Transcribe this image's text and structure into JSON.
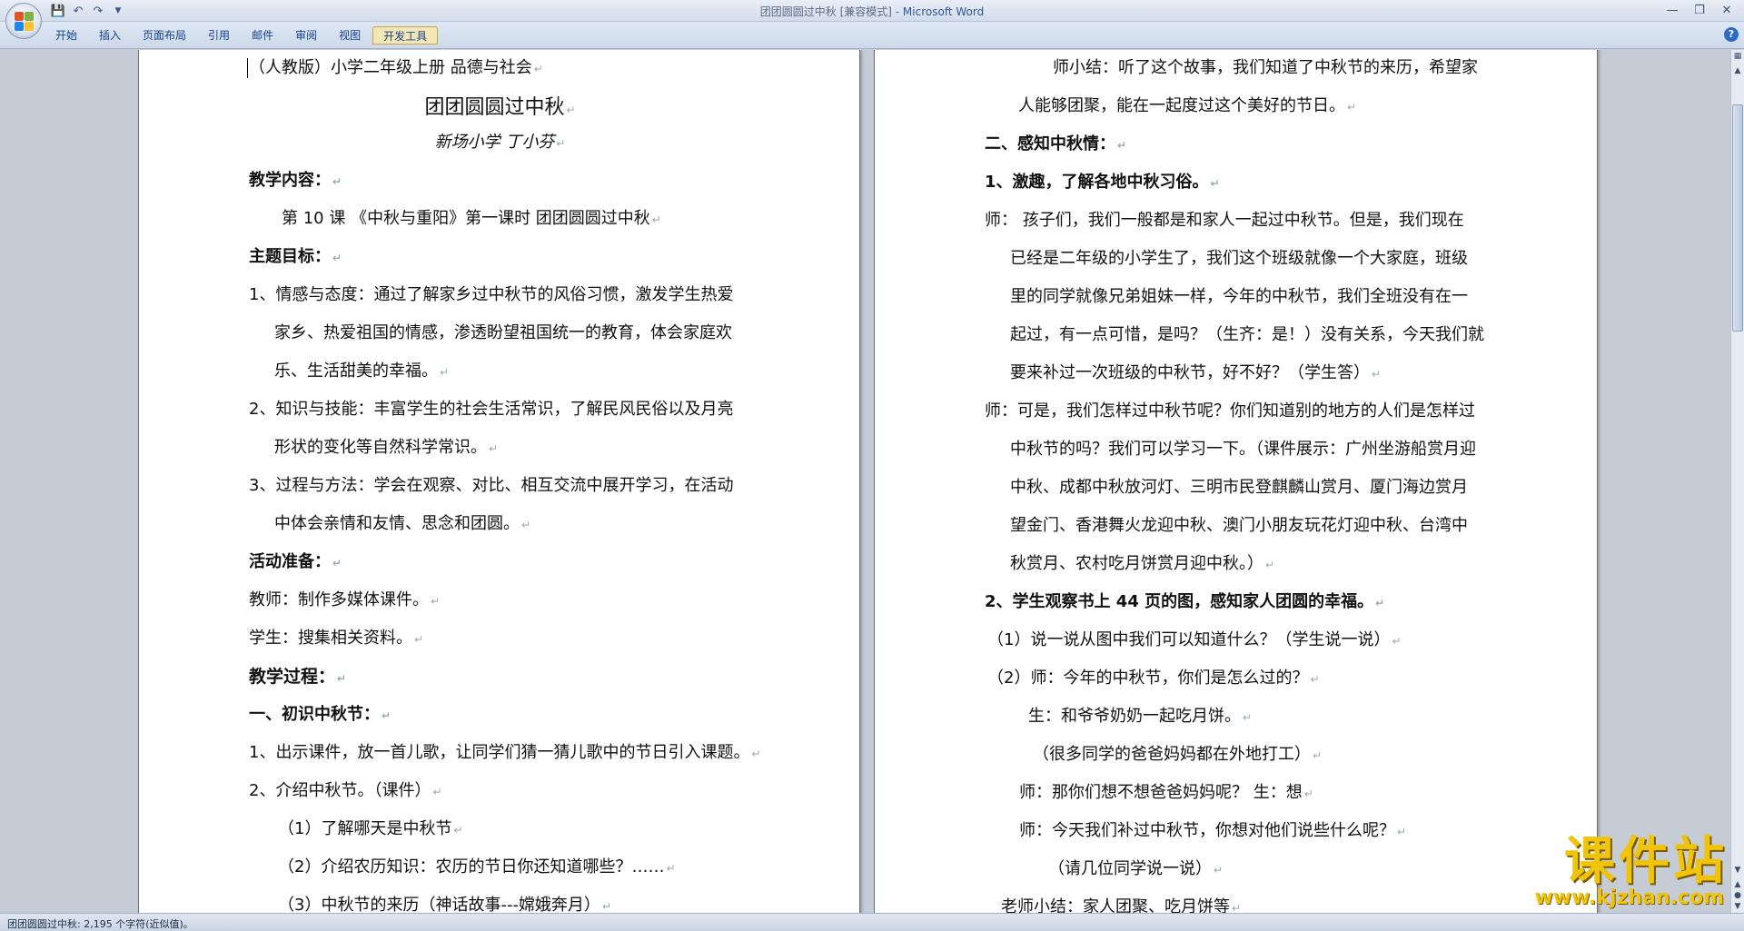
{
  "window": {
    "title_doc": "团团圆圆过中秋 [兼容模式] - ",
    "title_app": "Microsoft Word"
  },
  "quick_access": {
    "save_icon": "save-icon",
    "undo_icon": "undo-icon",
    "redo_icon": "redo-icon",
    "customize_icon": "dropdown-icon"
  },
  "ribbon": {
    "tabs": [
      {
        "label": "开始"
      },
      {
        "label": "插入"
      },
      {
        "label": "页面布局"
      },
      {
        "label": "引用"
      },
      {
        "label": "邮件"
      },
      {
        "label": "审阅"
      },
      {
        "label": "视图"
      },
      {
        "label": "开发工具"
      }
    ],
    "active_tab": "开发工具"
  },
  "doc": {
    "left": {
      "header_line": "（人教版）小学二年级上册  品德与社会",
      "title": "团团圆圆过中秋",
      "author": "新场小学  丁小芬",
      "h_content": "教学内容：",
      "lesson": "第 10 课  《中秋与重阳》第一课时  团团圆圆过中秋",
      "h_goals": "主题目标：",
      "g1_a": "1、情感与态度：通过了解家乡过中秋节的风俗习惯，激发学生热爱",
      "g1_b": "家乡、热爱祖国的情感，渗透盼望祖国统一的教育，体会家庭欢",
      "g1_c": "乐、生活甜美的幸福。",
      "g2_a": "2、知识与技能：丰富学生的社会生活常识，了解民风民俗以及月亮",
      "g2_b": "形状的变化等自然科学常识。",
      "g3_a": "3、过程与方法：学会在观察、对比、相互交流中展开学习，在活动",
      "g3_b": "中体会亲情和友情、思念和团圆。",
      "h_prep": "活动准备：",
      "prep_t": "教师：制作多媒体课件。",
      "prep_s": "学生：搜集相关资料。",
      "h_process": "教学过程：",
      "h_sec1": "一、初识中秋节：",
      "s1_1": "1、出示课件，放一首儿歌，让同学们猜一猜儿歌中的节日引入课题。",
      "s1_2": "2、介绍中秋节。（课件）",
      "s1_2a": "（1）了解哪天是中秋节",
      "s1_2b": "（2）介绍农历知识：农历的节日你还知道哪些？……",
      "s1_2c": "（3）中秋节的来历（神话故事---嫦娥奔月）"
    },
    "right": {
      "r1": "师小结：听了这个故事，我们知道了中秋节的来历，希望家",
      "r2": "人能够团聚，能在一起度过这个美好的节日。",
      "h_sec2": "二、感知中秋情：",
      "h_2_1": "1、激趣，了解各地中秋习俗。",
      "p1_a": "师：  孩子们，我们一般都是和家人一起过中秋节。但是，我们现在",
      "p1_b": "已经是二年级的小学生了，我们这个班级就像一个大家庭，班级",
      "p1_c": "里的同学就像兄弟姐妹一样，今年的中秋节，我们全班没有在一",
      "p1_d": "起过，有一点可惜，是吗？（生齐：是！）没有关系，今天我们就",
      "p1_e": "要来补过一次班级的中秋节，好不好？（学生答）",
      "p2_a": "师：可是，我们怎样过中秋节呢？你们知道别的地方的人们是怎样过",
      "p2_b": "中秋节的吗？我们可以学习一下。（课件展示：广州坐游船赏月迎",
      "p2_c": "中秋、成都中秋放河灯、三明市民登麒麟山赏月、厦门海边赏月",
      "p2_d": "望金门、香港舞火龙迎中秋、澳门小朋友玩花灯迎中秋、台湾中",
      "p2_e": "秋赏月、农村吃月饼赏月迎中秋。）",
      "h_2_2": "2、学生观察书上 44 页的图，感知家人团圆的幸福。",
      "q1": "（1）说一说从图中我们可以知道什么？（学生说一说）",
      "q2": "（2）师：今年的中秋节，你们是怎么过的？",
      "q2_a": "生：和爷爷奶奶一起吃月饼。",
      "q2_b": "（很多同学的爸爸妈妈都在外地打工）",
      "q2_c": "师：那你们想不想爸爸妈妈呢？  生：想",
      "q2_d": "师：今天我们补过中秋节，你想对他们说些什么呢？",
      "q2_e": "（请几位同学说一说）",
      "q2_f": "老师小结：家人团聚、吃月饼等"
    }
  },
  "paragraph_mark": "↵",
  "statusbar": {
    "text": "团团圆圆过中秋: 2,195 个字符(近似值)。"
  },
  "watermark": {
    "main": "课件站",
    "url": "www.kjzhan.com"
  }
}
